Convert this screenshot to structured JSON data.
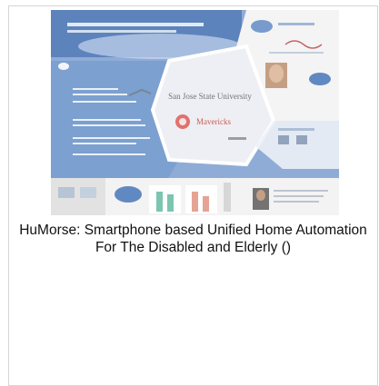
{
  "card": {
    "image_alt": "HuMorse: Smartphone based Unified Home Automation For The Disabled and Elderly poster",
    "poster_institution_text": "San Jose State University",
    "poster_logo_text": "Mavericks",
    "caption": "HuMorse: Smartphone based Unified Home Automation For The Disabled and Elderly ()"
  },
  "colors": {
    "poster_blue": "#4f7fc0",
    "poster_center": "#e9ecf3",
    "card_border": "#d6d6d6"
  }
}
